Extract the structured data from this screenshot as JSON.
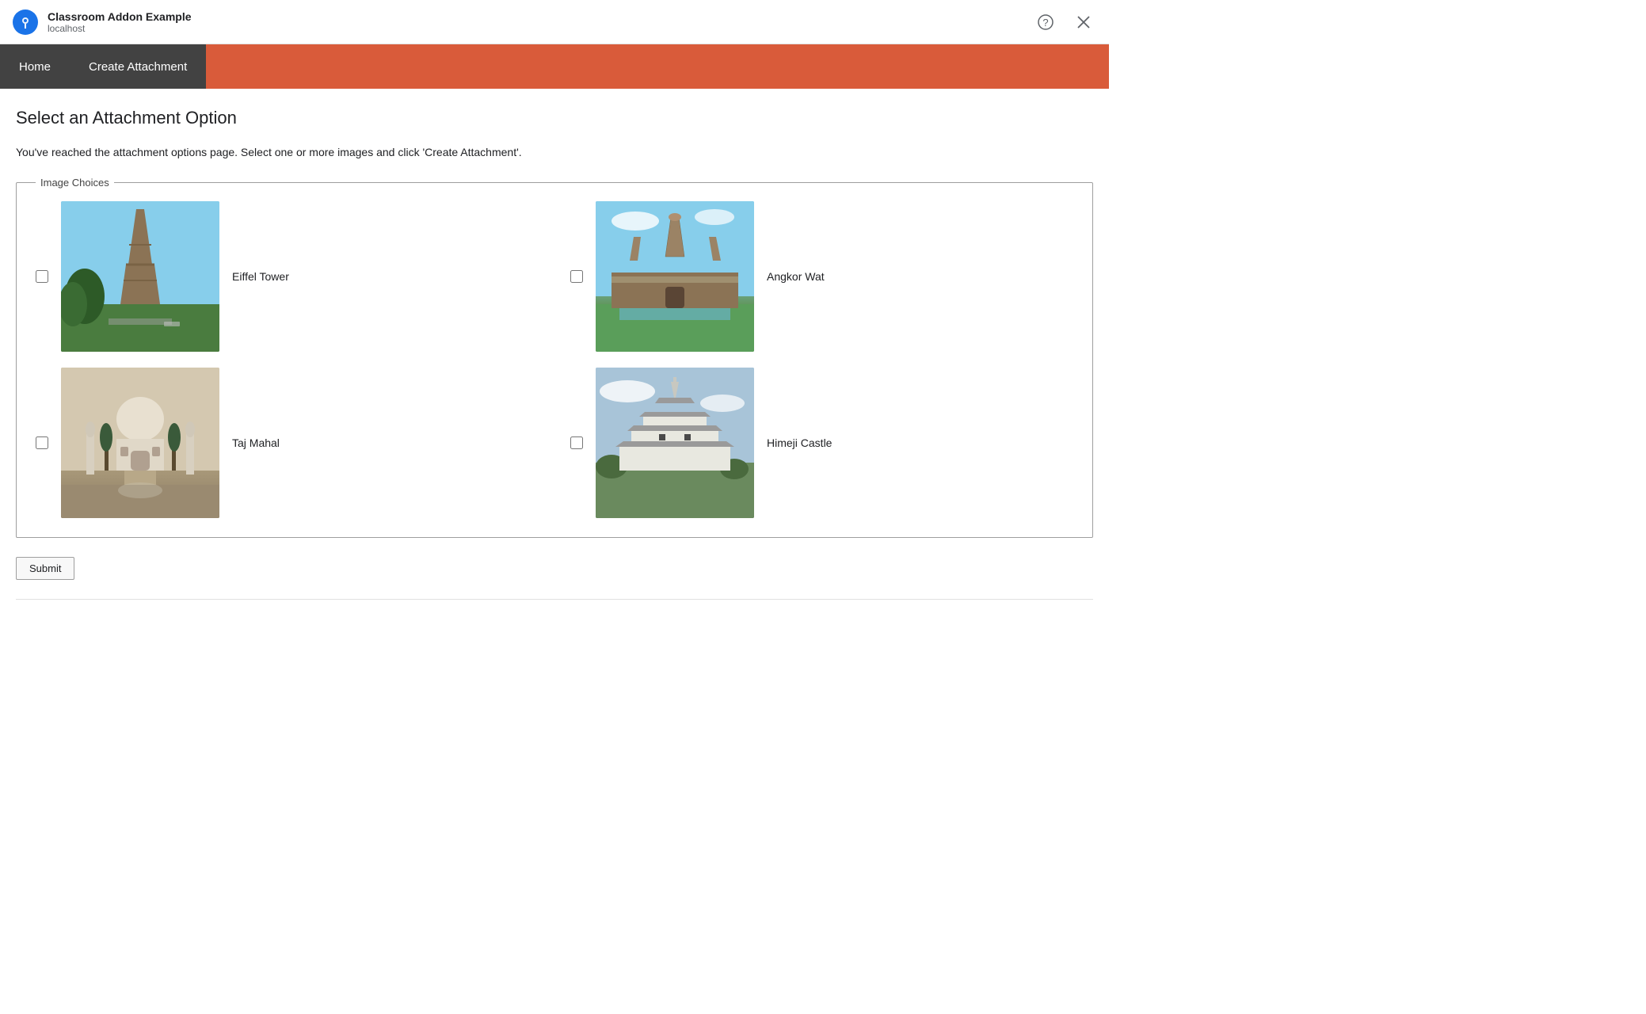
{
  "titlebar": {
    "app_title": "Classroom Addon Example",
    "app_subtitle": "localhost",
    "help_label": "?",
    "close_label": "×"
  },
  "navbar": {
    "items": [
      {
        "id": "home",
        "label": "Home"
      },
      {
        "id": "create-attachment",
        "label": "Create Attachment"
      }
    ]
  },
  "main": {
    "heading": "Select an Attachment Option",
    "description": "You've reached the attachment options page. Select one or more images and click 'Create Attachment'.",
    "fieldset_legend": "Image Choices",
    "images": [
      {
        "id": "eiffel-tower",
        "label": "Eiffel Tower",
        "checked": false
      },
      {
        "id": "angkor-wat",
        "label": "Angkor Wat",
        "checked": false
      },
      {
        "id": "taj-mahal",
        "label": "Taj Mahal",
        "checked": false
      },
      {
        "id": "himeji-castle",
        "label": "Himeji Castle",
        "checked": false
      }
    ],
    "submit_label": "Submit"
  }
}
